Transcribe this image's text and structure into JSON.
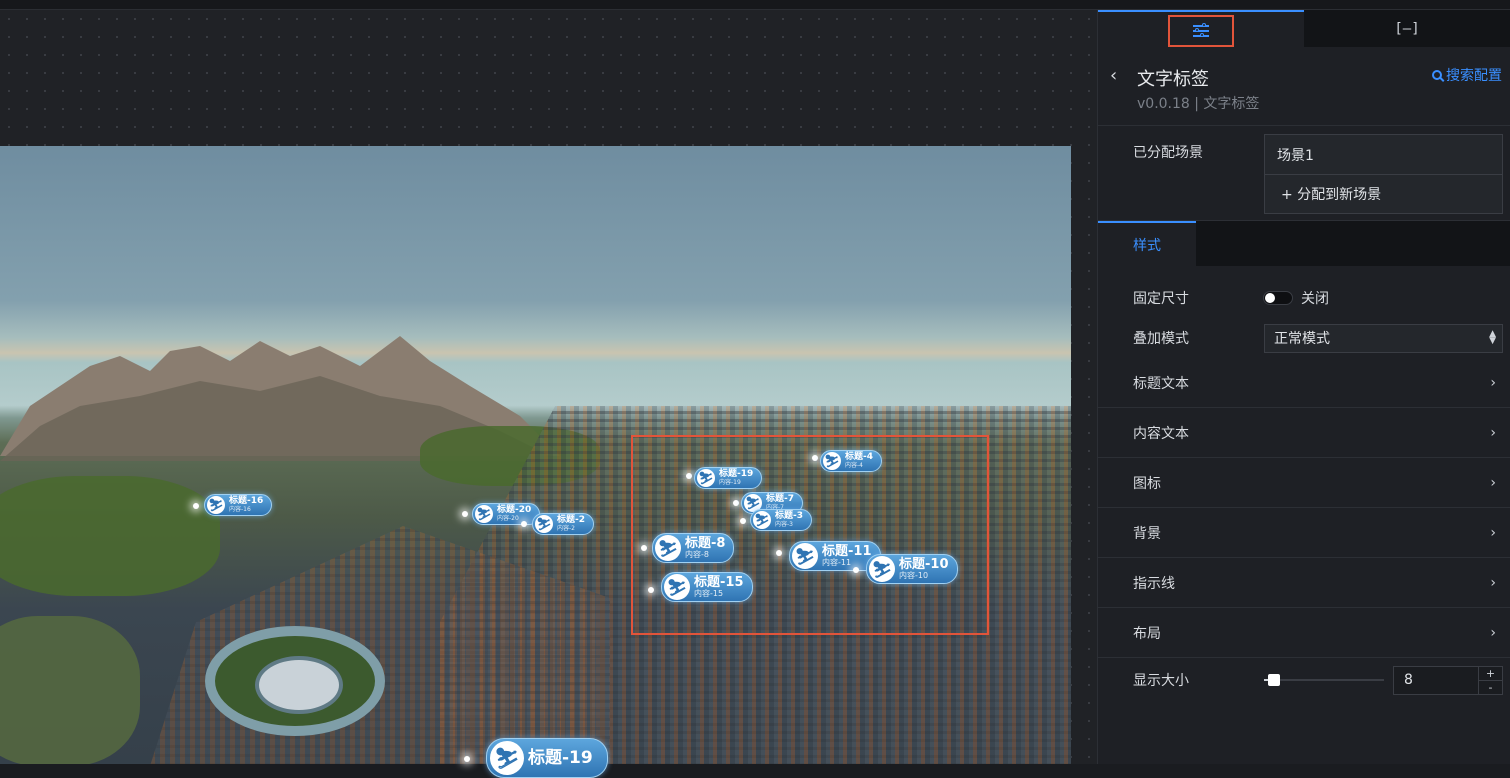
{
  "panel": {
    "tabs": [
      {
        "icon": "sliders-icon",
        "active": true
      },
      {
        "icon": "bracket-icon",
        "label": "[–]"
      }
    ],
    "back_icon": "‹",
    "title": "文字标签",
    "subtitle": "v0.0.18 | 文字标签",
    "search_label": "搜索配置",
    "scene": {
      "label": "已分配场景",
      "items": [
        "场景1",
        "+ 分配到新场景"
      ]
    },
    "style_tab": "样式",
    "settings": {
      "fixed_size": {
        "label": "固定尺寸",
        "value": "关闭"
      },
      "blend_mode": {
        "label": "叠加模式",
        "value": "正常模式"
      },
      "groups": [
        "标题文本",
        "内容文本",
        "图标",
        "背景",
        "指示线",
        "布局"
      ],
      "display_size": {
        "label": "显示大小",
        "value": "8",
        "plus": "+",
        "minus": "-"
      }
    }
  },
  "scene_tags": [
    {
      "title": "标题-16",
      "content": "内容-16"
    },
    {
      "title": "标题-20",
      "content": "内容-20"
    },
    {
      "title": "标题-2",
      "content": "内容-2"
    },
    {
      "title": "标题-19",
      "content": "内容-19"
    },
    {
      "title": "标题-4",
      "content": "内容-4"
    },
    {
      "title": "标题-7",
      "content": "内容-7"
    },
    {
      "title": "标题-3",
      "content": "内容-3"
    },
    {
      "title": "标题-8",
      "content": "内容-8"
    },
    {
      "title": "标题-11",
      "content": "内容-11"
    },
    {
      "title": "标题-10",
      "content": "内容-10"
    },
    {
      "title": "标题-15",
      "content": "内容-15"
    },
    {
      "title": "标题-19",
      "content": ""
    }
  ]
}
